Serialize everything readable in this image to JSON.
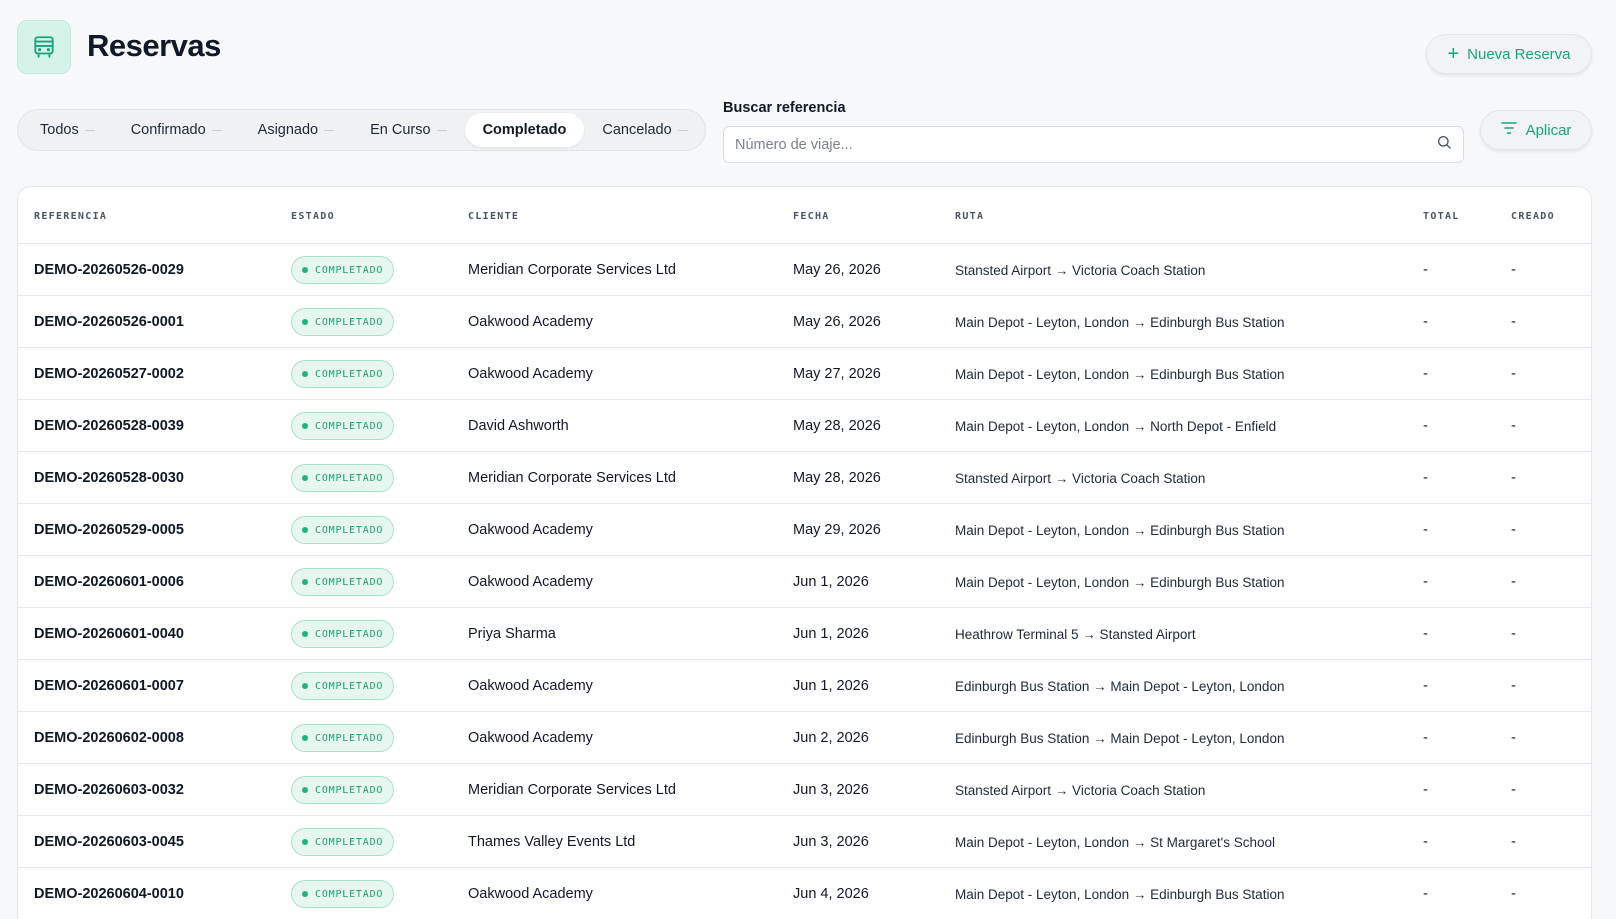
{
  "header": {
    "title": "Reservas",
    "icon": "bus-icon",
    "new_button_label": "Nueva Reserva"
  },
  "filters": {
    "tabs": [
      {
        "label": "Todos"
      },
      {
        "label": "Confirmado"
      },
      {
        "label": "Asignado"
      },
      {
        "label": "En Curso"
      },
      {
        "label": "Completado"
      },
      {
        "label": "Cancelado"
      }
    ],
    "active_tab": "Completado",
    "search_label": "Buscar referencia",
    "search_placeholder": "Número de viaje...",
    "search_value": "",
    "apply_label": "Aplicar"
  },
  "table": {
    "columns": {
      "reference": "REFERENCIA",
      "status": "ESTADO",
      "client": "CLIENTE",
      "date": "FECHA",
      "route": "RUTA",
      "total": "TOTAL",
      "created": "CREADO"
    },
    "rows": [
      {
        "reference": "DEMO-20260526-0029",
        "status": "COMPLETADO",
        "client": "Meridian Corporate Services Ltd",
        "date": "May 26, 2026",
        "route": "Stansted Airport → Victoria Coach Station",
        "total": "-",
        "created": "-"
      },
      {
        "reference": "DEMO-20260526-0001",
        "status": "COMPLETADO",
        "client": "Oakwood Academy",
        "date": "May 26, 2026",
        "route": "Main Depot - Leyton, London → Edinburgh Bus Station",
        "total": "-",
        "created": "-"
      },
      {
        "reference": "DEMO-20260527-0002",
        "status": "COMPLETADO",
        "client": "Oakwood Academy",
        "date": "May 27, 2026",
        "route": "Main Depot - Leyton, London → Edinburgh Bus Station",
        "total": "-",
        "created": "-"
      },
      {
        "reference": "DEMO-20260528-0039",
        "status": "COMPLETADO",
        "client": "David Ashworth",
        "date": "May 28, 2026",
        "route": "Main Depot - Leyton, London → North Depot - Enfield",
        "total": "-",
        "created": "-"
      },
      {
        "reference": "DEMO-20260528-0030",
        "status": "COMPLETADO",
        "client": "Meridian Corporate Services Ltd",
        "date": "May 28, 2026",
        "route": "Stansted Airport → Victoria Coach Station",
        "total": "-",
        "created": "-"
      },
      {
        "reference": "DEMO-20260529-0005",
        "status": "COMPLETADO",
        "client": "Oakwood Academy",
        "date": "May 29, 2026",
        "route": "Main Depot - Leyton, London → Edinburgh Bus Station",
        "total": "-",
        "created": "-"
      },
      {
        "reference": "DEMO-20260601-0006",
        "status": "COMPLETADO",
        "client": "Oakwood Academy",
        "date": "Jun 1, 2026",
        "route": "Main Depot - Leyton, London → Edinburgh Bus Station",
        "total": "-",
        "created": "-"
      },
      {
        "reference": "DEMO-20260601-0040",
        "status": "COMPLETADO",
        "client": "Priya Sharma",
        "date": "Jun 1, 2026",
        "route": "Heathrow Terminal 5 → Stansted Airport",
        "total": "-",
        "created": "-"
      },
      {
        "reference": "DEMO-20260601-0007",
        "status": "COMPLETADO",
        "client": "Oakwood Academy",
        "date": "Jun 1, 2026",
        "route": "Edinburgh Bus Station → Main Depot - Leyton, London",
        "total": "-",
        "created": "-"
      },
      {
        "reference": "DEMO-20260602-0008",
        "status": "COMPLETADO",
        "client": "Oakwood Academy",
        "date": "Jun 2, 2026",
        "route": "Edinburgh Bus Station → Main Depot - Leyton, London",
        "total": "-",
        "created": "-"
      },
      {
        "reference": "DEMO-20260603-0032",
        "status": "COMPLETADO",
        "client": "Meridian Corporate Services Ltd",
        "date": "Jun 3, 2026",
        "route": "Stansted Airport → Victoria Coach Station",
        "total": "-",
        "created": "-"
      },
      {
        "reference": "DEMO-20260603-0045",
        "status": "COMPLETADO",
        "client": "Thames Valley Events Ltd",
        "date": "Jun 3, 2026",
        "route": "Main Depot - Leyton, London → St Margaret's School",
        "total": "-",
        "created": "-"
      },
      {
        "reference": "DEMO-20260604-0010",
        "status": "COMPLETADO",
        "client": "Oakwood Academy",
        "date": "Jun 4, 2026",
        "route": "Main Depot - Leyton, London → Edinburgh Bus Station",
        "total": "-",
        "created": "-"
      }
    ]
  },
  "colors": {
    "accent": "#1aa37a",
    "badge_bg": "#e6f7ef",
    "badge_border": "#a8e0c8",
    "page_bg": "#f7f8fa"
  }
}
